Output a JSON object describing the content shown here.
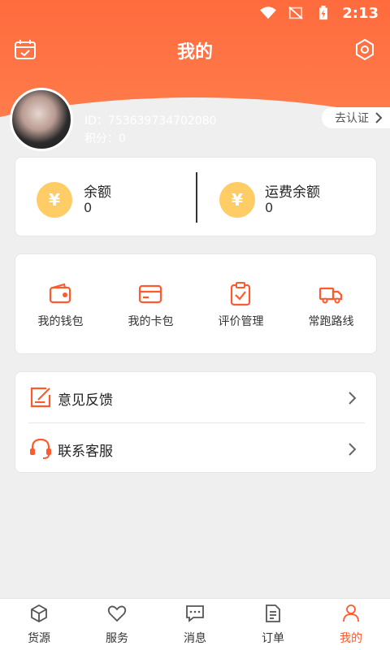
{
  "status_bar": {
    "time": "2:13"
  },
  "header": {
    "title": "我的",
    "left_icon": "calendar-icon",
    "right_icon": "settings-icon"
  },
  "profile": {
    "id_text": "ID：753639734702080",
    "points_text": "积分：0",
    "verify_label": "去认证"
  },
  "balance": {
    "items": [
      {
        "label": "余额",
        "value": "0",
        "icon": "yen-coin-icon"
      },
      {
        "label": "运费余额",
        "value": "0",
        "icon": "yen-coin-icon"
      }
    ]
  },
  "tools": [
    {
      "label": "我的钱包",
      "icon": "wallet-icon"
    },
    {
      "label": "我的卡包",
      "icon": "card-icon"
    },
    {
      "label": "评价管理",
      "icon": "clipboard-check-icon"
    },
    {
      "label": "常跑路线",
      "icon": "truck-icon"
    }
  ],
  "menu": [
    {
      "label": "意见反馈",
      "icon": "feedback-icon"
    },
    {
      "label": "联系客服",
      "icon": "headset-icon"
    }
  ],
  "tabbar": {
    "tabs": [
      {
        "label": "货源",
        "icon": "cube-icon",
        "active": false
      },
      {
        "label": "服务",
        "icon": "heart-icon",
        "active": false
      },
      {
        "label": "消息",
        "icon": "chat-icon",
        "active": false
      },
      {
        "label": "订单",
        "icon": "document-icon",
        "active": false
      },
      {
        "label": "我的",
        "icon": "person-icon",
        "active": true
      }
    ]
  },
  "colors": {
    "accent": "#ff5a2e",
    "header": "#ff6b3d",
    "coin": "#ffcc66"
  }
}
